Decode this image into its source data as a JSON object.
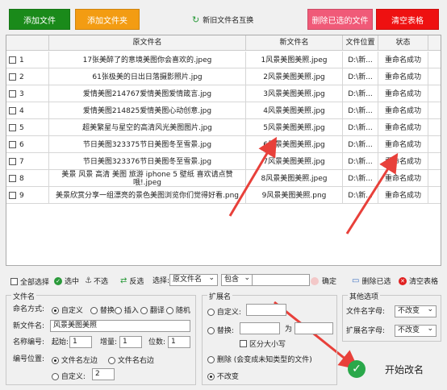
{
  "toolbar": {
    "add_file": "添加文件",
    "add_folder": "添加文件夹",
    "swap": "新旧文件名互换",
    "delete_selected": "删除已选的文件",
    "clear_table": "清空表格"
  },
  "table": {
    "columns": [
      "原文件名",
      "新文件名",
      "文件位置",
      "状态"
    ],
    "rows": [
      {
        "no": "1",
        "orig": "17张美醉了的意境美图你会喜欢的.jpeg",
        "new": "1风景美图美照.jpeg",
        "loc": "D:\\新...",
        "status": "重命名成功"
      },
      {
        "no": "2",
        "orig": "61张极美的日出日落摄影照片.jpg",
        "new": "2风景美图美照.jpg",
        "loc": "D:\\新...",
        "status": "重命名成功"
      },
      {
        "no": "3",
        "orig": "爱情美图214767爱情美图爱情箴言.jpg",
        "new": "3风景美图美照.jpg",
        "loc": "D:\\新...",
        "status": "重命名成功"
      },
      {
        "no": "4",
        "orig": "爱情美图214825爱情美图心动创意.jpg",
        "new": "4风景美图美照.jpg",
        "loc": "D:\\新...",
        "status": "重命名成功"
      },
      {
        "no": "5",
        "orig": "超美繁星与星空的高清风光美图图片.jpg",
        "new": "5风景美图美照.jpg",
        "loc": "D:\\新...",
        "status": "重命名成功"
      },
      {
        "no": "6",
        "orig": "节日美图323375节日美图冬至雪景.jpg",
        "new": "6风景美图美照.jpg",
        "loc": "D:\\新...",
        "status": "重命名成功"
      },
      {
        "no": "7",
        "orig": "节日美图323376节日美图冬至雪景.jpg",
        "new": "7风景美图美照.jpg",
        "loc": "D:\\新...",
        "status": "重命名成功"
      },
      {
        "no": "8",
        "orig": "美景 风景 高清 美图 旅游 iphone 5 壁纸 喜欢请点赞哦!.jpeg",
        "new": "8风景美图美照.jpeg",
        "loc": "D:\\新...",
        "status": "重命名成功"
      },
      {
        "no": "9",
        "orig": "美景欣赏分享一组漂亮的景色美图浏览你们觉得好看.png",
        "new": "9风景美图美照.png",
        "loc": "D:\\新...",
        "status": "重命名成功"
      }
    ]
  },
  "selbar": {
    "select_all": "全部选择",
    "select": "选中",
    "unselect": "不选",
    "invert": "反选",
    "choose_label": "选择:",
    "field_value": "原文件名",
    "op_value": "包含",
    "confirm": "确定",
    "delete_selected": "删除已选",
    "clear_table": "清空表格"
  },
  "filename": {
    "group": "文件名",
    "mode_label": "命名方式:",
    "modes": [
      "自定义",
      "替换",
      "插入",
      "翻译",
      "随机"
    ],
    "new_name_label": "新文件名:",
    "new_name_value": "风景美图美照",
    "numbering_label": "名称编号:",
    "start_label": "起始:",
    "start_value": "1",
    "step_label": "增量:",
    "step_value": "1",
    "digits_label": "位数:",
    "digits_value": "1",
    "pos_label": "编号位置:",
    "pos_left": "文件名左边",
    "pos_right": "文件名右边",
    "pos_custom": "自定义:",
    "pos_custom_value": "2"
  },
  "ext": {
    "group": "扩展名",
    "custom": "自定义:",
    "replace": "替换:",
    "as": "为",
    "case_insensitive": "区分大小写",
    "delete": "删除 (会变成未知类型的文件)",
    "keep": "不改变"
  },
  "other": {
    "group": "其他选项",
    "name_case_label": "文件名字母:",
    "name_case_value": "不改变",
    "ext_case_label": "扩展名字母:",
    "ext_case_value": "不改变"
  },
  "start_button": "开始改名",
  "colors": {
    "add_file": "#1a8a1a",
    "add_folder": "#f39c12",
    "delete_selected": "#f05a78",
    "clear_table": "#ee1111",
    "arrow": "#e8403a"
  }
}
